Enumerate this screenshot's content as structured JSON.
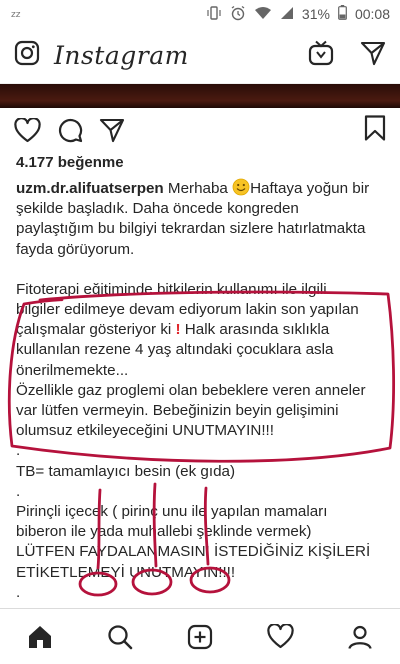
{
  "status_bar": {
    "battery": "31%",
    "time": "00:08",
    "icons": [
      "sleep-zz-icon",
      "vibrate-icon",
      "alarm-icon",
      "wifi-icon",
      "signal-icon",
      "battery-icon"
    ]
  },
  "app_bar": {
    "title": "Instagram",
    "icons": [
      "camera-icon",
      "igtv-icon",
      "direct-message-icon"
    ]
  },
  "post": {
    "actions": [
      "heart-icon",
      "comment-icon",
      "share-icon",
      "bookmark-icon"
    ],
    "likes": "4.177 beğenme",
    "username": "uzm.dr.alifuatserpen",
    "caption_lines": [
      " Merhaba ",
      "Haftaya yoğun bir",
      "şekilde başladık. Daha öncede kongreden",
      "paylaştığım bu bilgiyi tekrardan sizlere hatırlatmakta",
      "fayda görüyorum.",
      "Fitoterapi eğitiminde bitkilerin kullanımı ile ilgili",
      "bilgiler edilmeye devam ediyorum lakin son yapılan",
      "çalışmalar gösteriyor ki ",
      "  Halk arasında sıklıkla",
      "kullanılan rezene 4 yaş altındaki çocuklara asla",
      "önerilmemekte...",
      "Özellikle gaz proglemi olan bebeklere veren anneler",
      "var lütfen vermeyin. Bebeğinizin beyin gelişimini",
      "olumsuz etkileyeceğini  UNUTMAYIN!!!",
      ".",
      "TB= tamamlayıcı besin (ek gıda)",
      ".",
      "Pirinçli içecek ( pirinç unu ile yapılan mamaları",
      "biberon  ile yada muhallebi şeklinde vermek)",
      "LÜTFEN FAYDALANMASINI İSTEDİĞİNİZ KİŞİLERİ",
      "ETİKETLEMEYİ UNUTMAYIN!!!!",
      "."
    ],
    "emoji": [
      "smiling-face-emoji",
      "exclamation-emoji"
    ],
    "annotation_color": "#b5123c"
  },
  "bottom_nav": [
    "home-icon",
    "search-icon",
    "add-post-icon",
    "activity-heart-icon",
    "profile-icon"
  ]
}
